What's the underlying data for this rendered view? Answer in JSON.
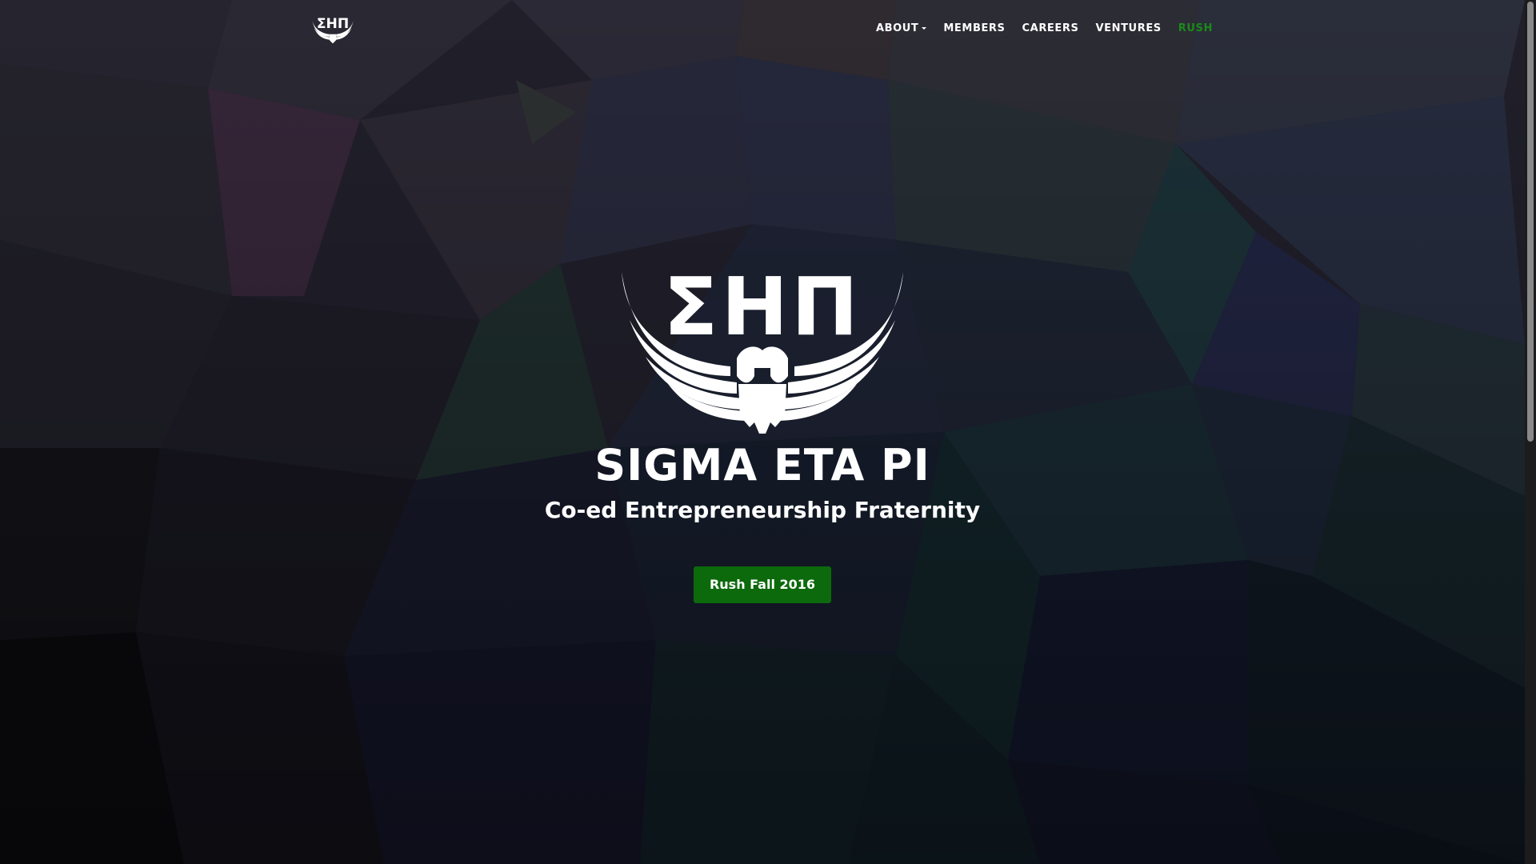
{
  "nav": {
    "logo_text": "ΣΗΠ",
    "links": [
      {
        "label": "ABOUT",
        "has_dropdown": true,
        "active": false
      },
      {
        "label": "MEMBERS",
        "has_dropdown": false,
        "active": false
      },
      {
        "label": "CAREERS",
        "has_dropdown": false,
        "active": false
      },
      {
        "label": "VENTURES",
        "has_dropdown": false,
        "active": false
      },
      {
        "label": "RUSH",
        "has_dropdown": false,
        "active": true
      }
    ]
  },
  "hero": {
    "logo_text": "ΣΗΠ",
    "title": "SIGMA ETA PI",
    "subtitle": "Co-ed Entrepreneurship Fraternity",
    "button_label": "Rush Fall 2016"
  },
  "colors": {
    "accent_green": "#0c6a0c",
    "active_link": "#1a8a1a",
    "text": "#ffffff"
  },
  "icons": {
    "logo": "eagle-emblem-icon",
    "dropdown": "caret-down-icon"
  }
}
